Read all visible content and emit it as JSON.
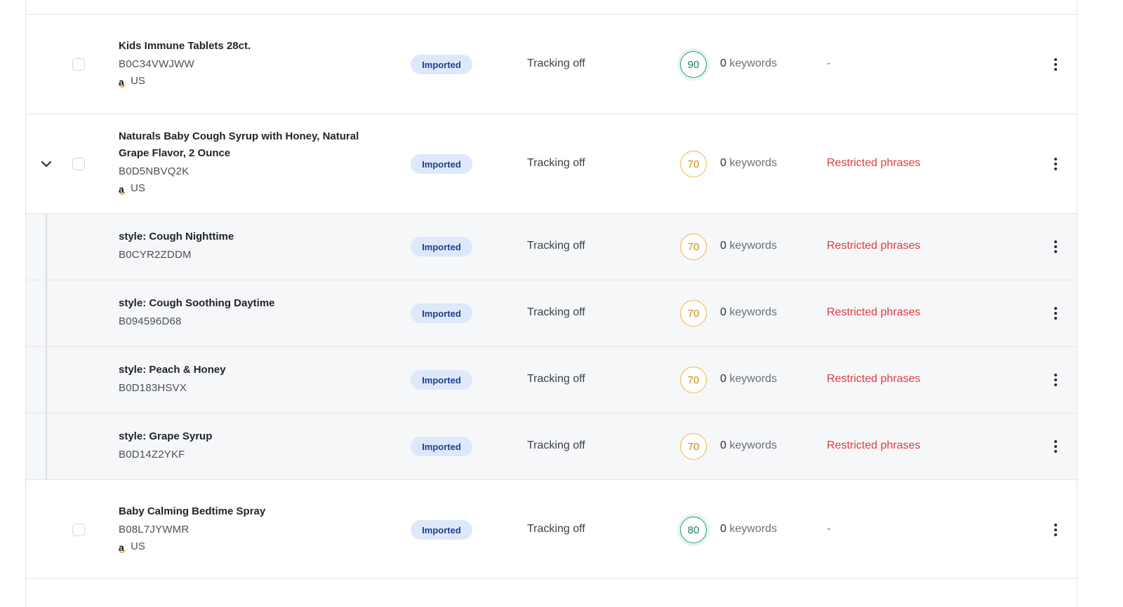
{
  "rows": [
    {
      "kind": "parent",
      "name": "Kids Immune Tablets 28ct.",
      "asin": "B0C34VWJWW",
      "market": "US",
      "status": "Imported",
      "tracking": "Tracking off",
      "score": "90",
      "keywords_count": "0",
      "keywords_label": "keywords",
      "compliance": "-"
    },
    {
      "kind": "parent",
      "expanded": true,
      "name": "Naturals Baby Cough Syrup with Honey, Natural Grape Flavor, 2 Ounce",
      "asin": "B0D5NBVQ2K",
      "market": "US",
      "status": "Imported",
      "tracking": "Tracking off",
      "score": "70",
      "keywords_count": "0",
      "keywords_label": "keywords",
      "compliance": "Restricted phrases"
    },
    {
      "kind": "variant",
      "name": "style: Cough Nighttime",
      "asin": "B0CYR2ZDDM",
      "status": "Imported",
      "tracking": "Tracking off",
      "score": "70",
      "keywords_count": "0",
      "keywords_label": "keywords",
      "compliance": "Restricted phrases"
    },
    {
      "kind": "variant",
      "name": "style: Cough Soothing Daytime",
      "asin": "B094596D68",
      "status": "Imported",
      "tracking": "Tracking off",
      "score": "70",
      "keywords_count": "0",
      "keywords_label": "keywords",
      "compliance": "Restricted phrases"
    },
    {
      "kind": "variant",
      "name": "style: Peach & Honey",
      "asin": "B0D183HSVX",
      "status": "Imported",
      "tracking": "Tracking off",
      "score": "70",
      "keywords_count": "0",
      "keywords_label": "keywords",
      "compliance": "Restricted phrases"
    },
    {
      "kind": "variant",
      "name": "style: Grape Syrup",
      "asin": "B0D14Z2YKF",
      "status": "Imported",
      "tracking": "Tracking off",
      "score": "70",
      "keywords_count": "0",
      "keywords_label": "keywords",
      "compliance": "Restricted phrases"
    },
    {
      "kind": "parent",
      "name": "Baby Calming Bedtime Spray",
      "asin": "B08L7JYWMR",
      "market": "US",
      "status": "Imported",
      "tracking": "Tracking off",
      "score": "80",
      "keywords_count": "0",
      "keywords_label": "keywords",
      "compliance": "-"
    }
  ],
  "colors": {
    "badge_bg": "#dde8fb",
    "badge_text": "#1d3f8a",
    "score_good": "#2a9d6a",
    "score_mid": "#f0b63a",
    "warning_text": "#e5383b",
    "variant_bg": "#f6f7f9"
  },
  "icons": {
    "expand": "chevron-down-icon",
    "actions": "more-vertical-icon",
    "marketplace": "amazon-icon"
  }
}
